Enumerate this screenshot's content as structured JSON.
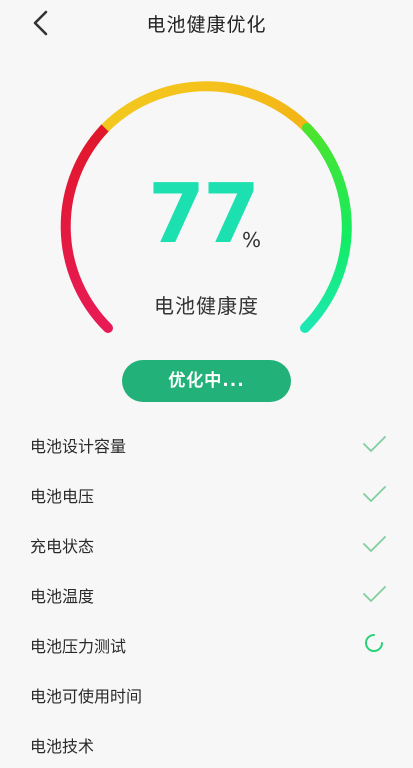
{
  "header": {
    "title": "电池健康优化",
    "back_icon": "back-arrow-icon"
  },
  "gauge": {
    "value": 77,
    "unit": "%",
    "label": "电池健康度",
    "colors": {
      "low": "#e8184a",
      "mid": "#f5c21c",
      "high": "#2ee86a",
      "value": "#1de0b0"
    }
  },
  "action": {
    "label": "优化中..."
  },
  "checks": [
    {
      "label": "电池设计容量",
      "status": "done",
      "icon": "check-icon"
    },
    {
      "label": "电池电压",
      "status": "done",
      "icon": "check-icon"
    },
    {
      "label": "充电状态",
      "status": "done",
      "icon": "check-icon"
    },
    {
      "label": "电池温度",
      "status": "done",
      "icon": "check-icon"
    },
    {
      "label": "电池压力测试",
      "status": "in-progress",
      "icon": "loading-spinner-icon"
    },
    {
      "label": "电池可使用时间",
      "status": "pending",
      "icon": ""
    },
    {
      "label": "电池技术",
      "status": "pending",
      "icon": ""
    }
  ],
  "accent": "#22b178"
}
